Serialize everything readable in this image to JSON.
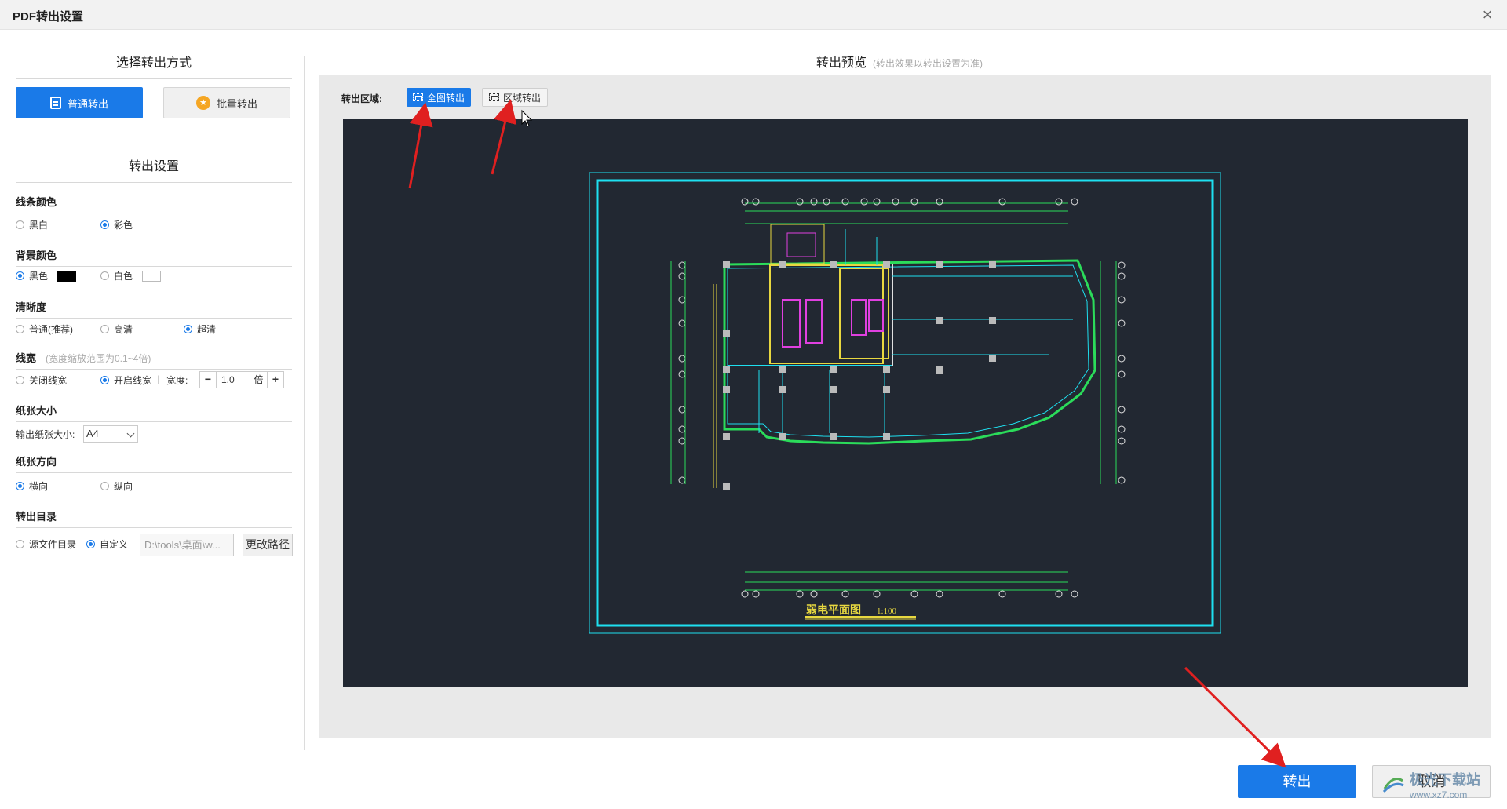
{
  "window": {
    "title": "PDF转出设置"
  },
  "left": {
    "mode_title": "选择转出方式",
    "mode_buttons": [
      {
        "label": "普通转出",
        "active": true
      },
      {
        "label": "批量转出",
        "active": false
      }
    ],
    "settings_title": "转出设置",
    "line_color": {
      "label": "线条颜色",
      "options": [
        "黑白",
        "彩色"
      ],
      "selected": "彩色"
    },
    "bg_color": {
      "label": "背景颜色",
      "options": [
        "黑色",
        "白色"
      ],
      "selected": "黑色"
    },
    "clarity": {
      "label": "清晰度",
      "options": [
        "普通(推荐)",
        "高清",
        "超清"
      ],
      "selected": "超清"
    },
    "line_width": {
      "label": "线宽",
      "hint": "(宽度缩放范围为0.1~4倍)",
      "options": [
        "关闭线宽",
        "开启线宽"
      ],
      "selected": "开启线宽",
      "width_label": "宽度:",
      "width_value": "1.0",
      "width_unit": "倍",
      "minus": "−",
      "plus": "+"
    },
    "paper_size": {
      "label": "纸张大小",
      "field_label": "输出纸张大小:",
      "value": "A4"
    },
    "orientation": {
      "label": "纸张方向",
      "options": [
        "横向",
        "纵向"
      ],
      "selected": "横向"
    },
    "output_dir": {
      "label": "转出目录",
      "options": [
        "源文件目录",
        "自定义"
      ],
      "selected": "自定义",
      "path_value": "D:\\tools\\桌面\\w...",
      "change_button": "更改路径"
    }
  },
  "preview": {
    "title": "转出预览",
    "hint": "(转出效果以转出设置为准)",
    "region_label": "转出区域:",
    "region_buttons": [
      {
        "label": "全图转出",
        "active": true
      },
      {
        "label": "区域转出",
        "active": false
      }
    ],
    "drawing_caption": "弱电平面图",
    "drawing_scale": "1:100"
  },
  "footer": {
    "export": "转出",
    "cancel": "取消"
  },
  "watermark": {
    "line1": "极光下载站",
    "line2": "www.xz7.com"
  },
  "colors": {
    "accent": "#1a7ae8",
    "canvas_bg": "#222832",
    "frame_cyan": "#1ee0f0",
    "cad_green": "#2bdc5a",
    "cad_magenta": "#e040e0",
    "cad_yellow": "#e8d840",
    "arrow_red": "#e02020"
  }
}
